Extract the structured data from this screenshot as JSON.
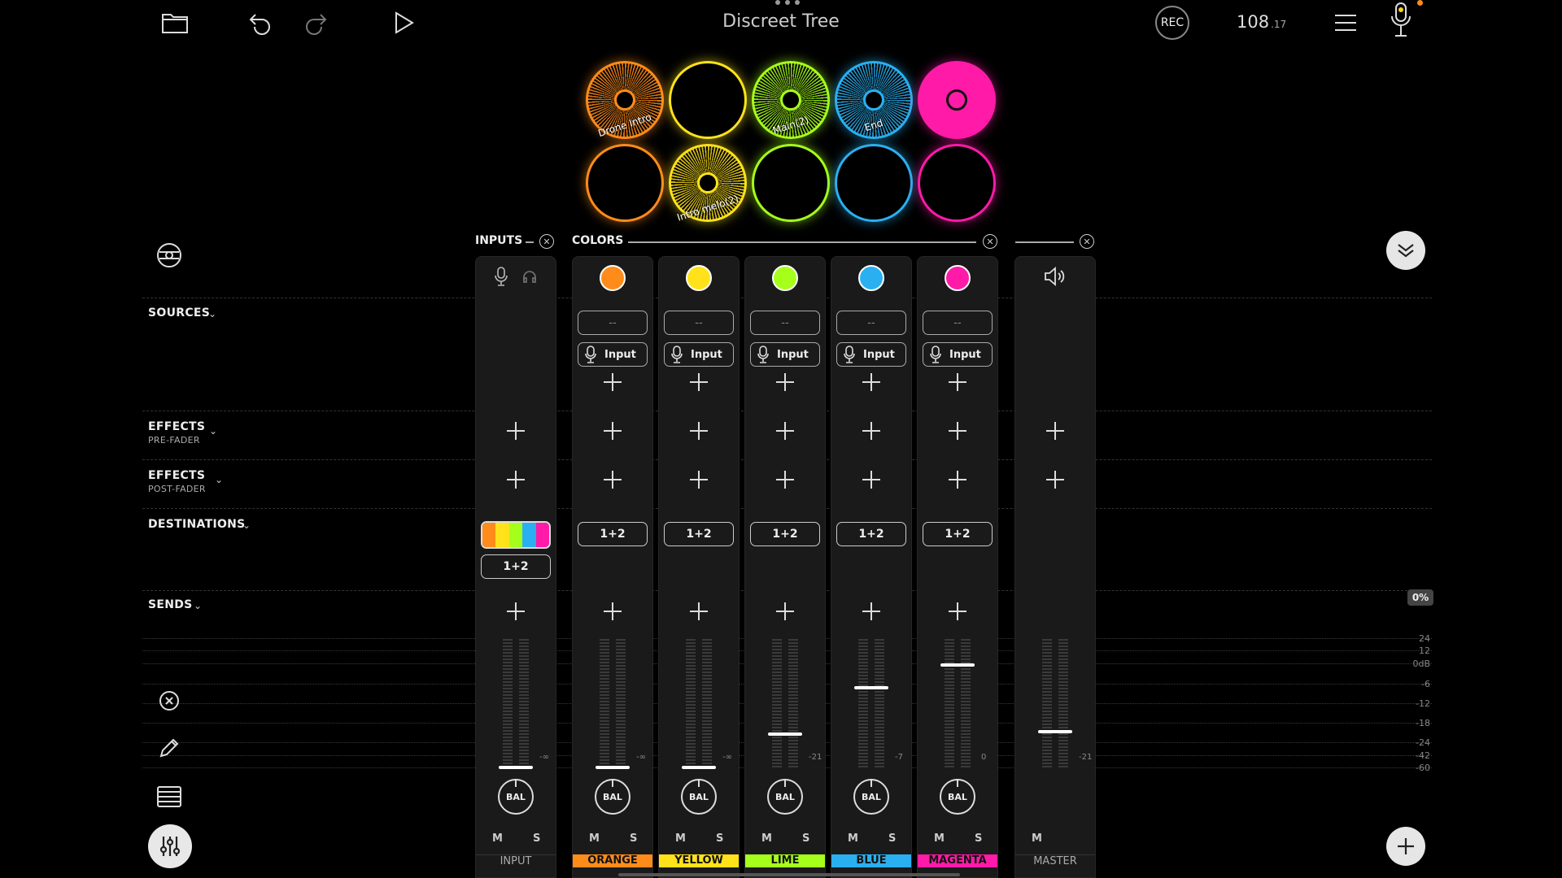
{
  "header": {
    "title": "Discreet Tree",
    "rec_label": "REC",
    "tempo_main": "108",
    "tempo_fraction": ".17"
  },
  "pads": [
    {
      "label": "Drone Intro",
      "color": "#ff8c1a",
      "state": "loop"
    },
    {
      "label": "",
      "color": "#ffe21a",
      "state": "empty"
    },
    {
      "label": "Main(2)",
      "color": "#a6ff1a",
      "state": "loop"
    },
    {
      "label": "End",
      "color": "#2ab0f0",
      "state": "loop"
    },
    {
      "label": "",
      "color": "#ff1aa8",
      "state": "full"
    },
    {
      "label": "",
      "color": "#ff8c1a",
      "state": "empty"
    },
    {
      "label": "Intro melo(2)",
      "color": "#ffe21a",
      "state": "loop"
    },
    {
      "label": "",
      "color": "#a6ff1a",
      "state": "empty"
    },
    {
      "label": "",
      "color": "#2ab0f0",
      "state": "empty"
    },
    {
      "label": "",
      "color": "#ff1aa8",
      "state": "empty"
    }
  ],
  "sections": {
    "inputs": "INPUTS",
    "colors": "COLORS",
    "sources": "SOURCES",
    "effects_pre": "EFFECTS",
    "effects_pre_sub": "PRE-FADER",
    "effects_post": "EFFECTS",
    "effects_post_sub": "POST-FADER",
    "destinations": "DESTINATIONS",
    "sends": "SENDS",
    "send_percent": "0%"
  },
  "channels": {
    "input": {
      "name": "INPUT",
      "dest": "1+2",
      "peak": "-∞",
      "fader_level": 0.0
    },
    "orange": {
      "name": "ORANGE",
      "color": "#ff8c1a",
      "source": "--",
      "source_input": "Input",
      "dest": "1+2",
      "peak": "-∞",
      "fader_level": 0.0
    },
    "yellow": {
      "name": "YELLOW",
      "color": "#ffe21a",
      "source": "--",
      "source_input": "Input",
      "dest": "1+2",
      "peak": "-∞",
      "fader_level": 0.0
    },
    "lime": {
      "name": "LIME",
      "color": "#a6ff1a",
      "source": "--",
      "source_input": "Input",
      "dest": "1+2",
      "peak": "-21",
      "fader_level": 0.26
    },
    "blue": {
      "name": "BLUE",
      "color": "#2ab0f0",
      "source": "--",
      "source_input": "Input",
      "dest": "1+2",
      "peak": "-7",
      "fader_level": 0.62
    },
    "magenta": {
      "name": "MAGENTA",
      "color": "#ff1aa8",
      "source": "--",
      "source_input": "Input",
      "dest": "1+2",
      "peak": "0",
      "fader_level": 0.8
    },
    "master": {
      "name": "MASTER",
      "peak": "-21",
      "fader_level": 0.28
    }
  },
  "mute_label": "M",
  "solo_label": "S",
  "bal_label": "BAL",
  "db_scale": [
    "24",
    "12",
    "0dB",
    "-6",
    "-12",
    "-18",
    "-24",
    "-42",
    "-60"
  ],
  "rainbow_colors": [
    "#ff8c1a",
    "#ffe21a",
    "#a6ff1a",
    "#2ab0f0",
    "#ff1aa8"
  ]
}
